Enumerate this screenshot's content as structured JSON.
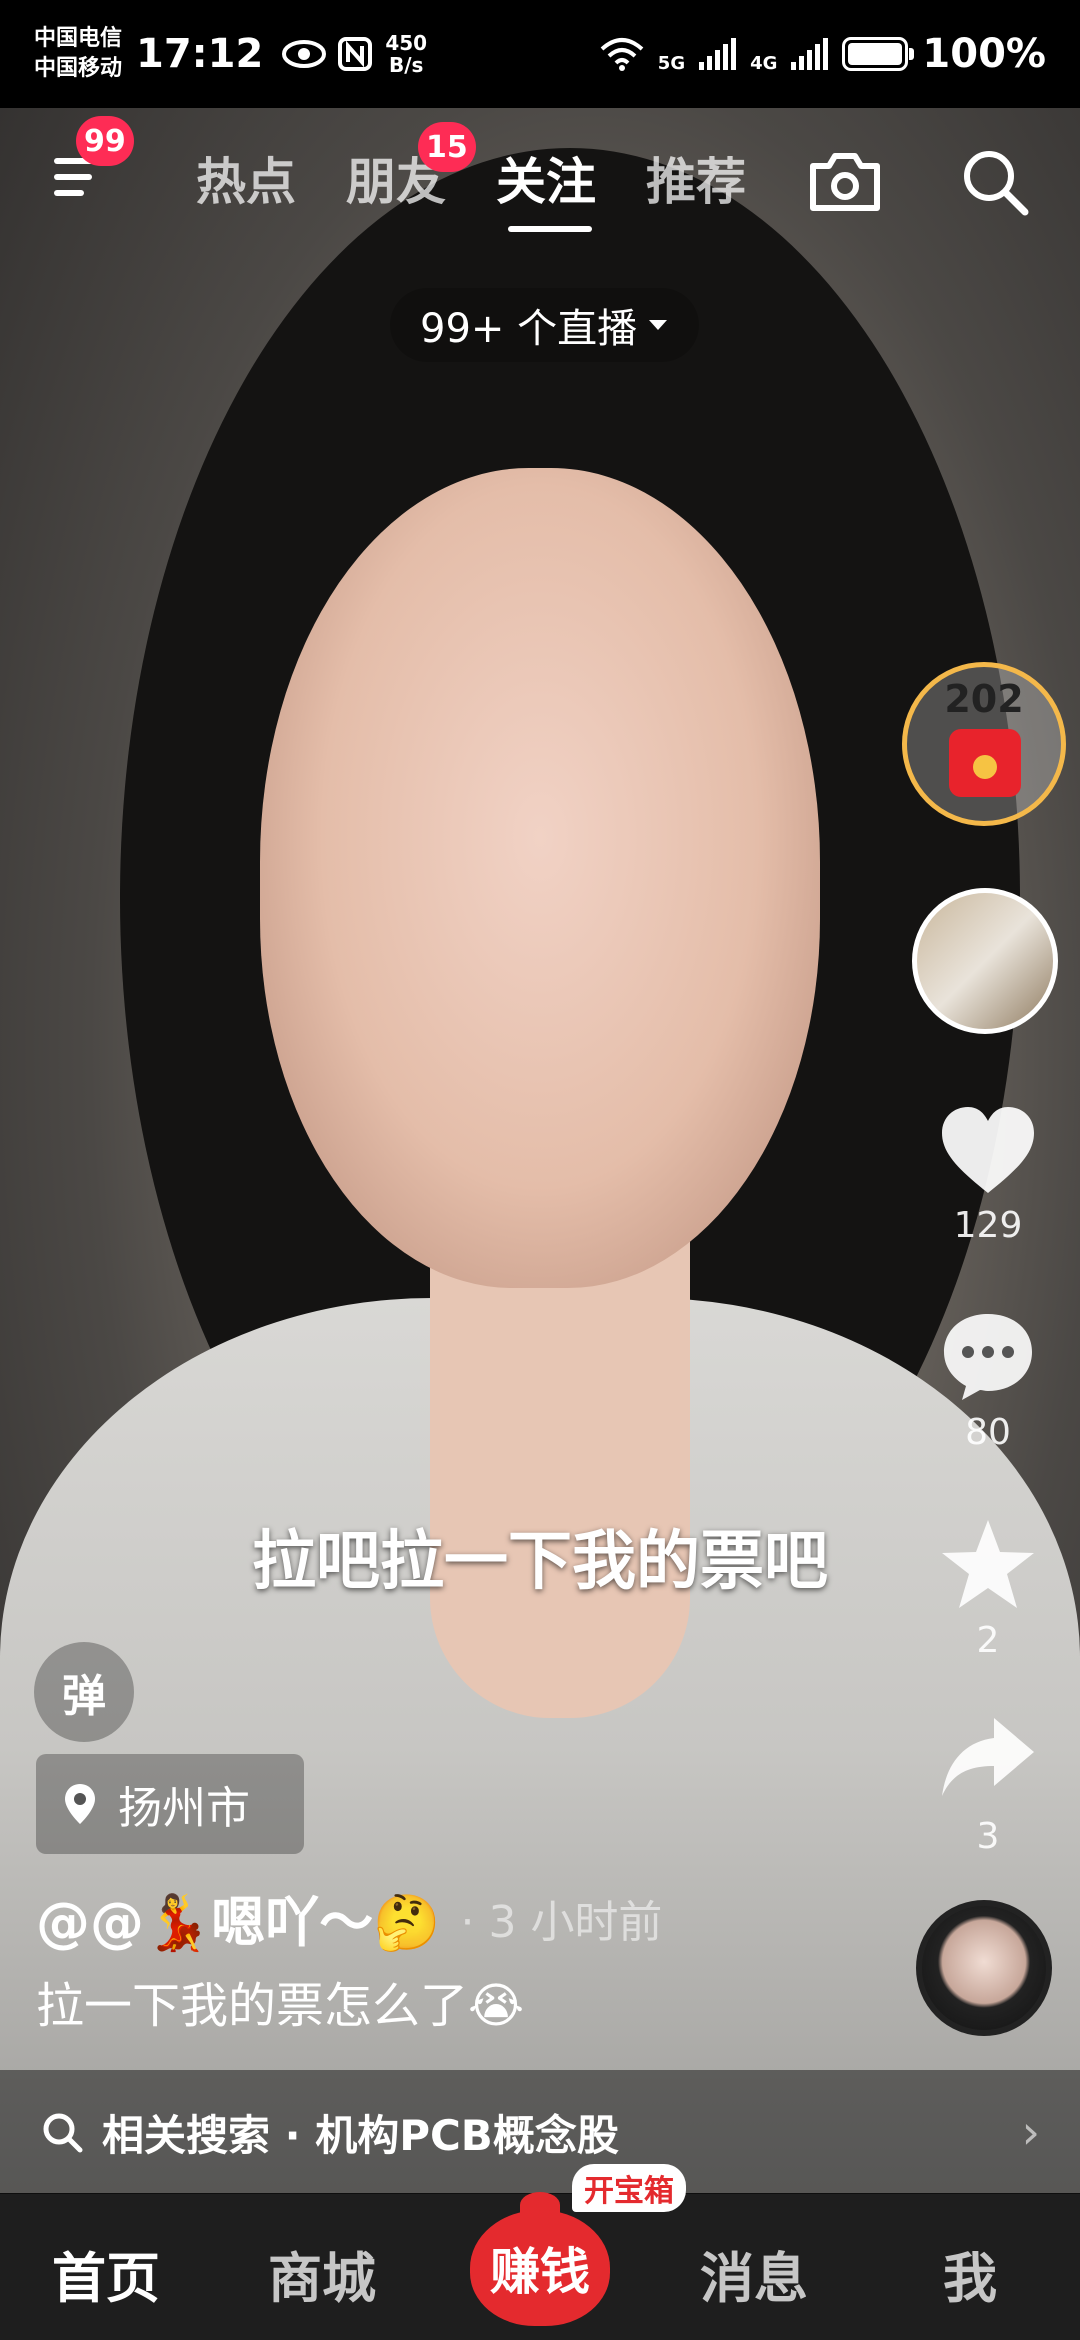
{
  "status_bar": {
    "carrier_1": "中国电信",
    "carrier_2": "中国移动",
    "time": "17:12",
    "net_speed_value": "450",
    "net_speed_unit": "B/s",
    "net_type_1": "5G",
    "net_type_2": "4G",
    "battery": "100%"
  },
  "top_nav": {
    "menu_badge": "99",
    "tabs": [
      {
        "label": "热点"
      },
      {
        "label": "朋友",
        "badge": "15"
      },
      {
        "label": "关注"
      },
      {
        "label": "推荐"
      }
    ],
    "active_tab": "关注"
  },
  "live_pill": {
    "label": "99+ 个直播"
  },
  "right_rail": {
    "red_packet_count": "202",
    "likes": "129",
    "comments": "80",
    "favorites": "2",
    "shares": "3"
  },
  "video": {
    "caption_overlay": "拉吧拉一下我的票吧",
    "danmu_label": "弹",
    "location": "扬州市",
    "author": "@@💃嗯吖～🤔",
    "time_ago": "· 3 小时前",
    "description": "拉一下我的票怎么了😭"
  },
  "related_search": {
    "label": "相关搜索 · 机构PCB概念股"
  },
  "bottom_nav": {
    "home": "首页",
    "mall": "商城",
    "earn": "赚钱",
    "earn_tag": "开宝箱",
    "messages": "消息",
    "me": "我"
  },
  "colors": {
    "accent_red": "#fe2c55",
    "earn_red": "#e42a2e",
    "gold_ring": "#f4b84a"
  }
}
